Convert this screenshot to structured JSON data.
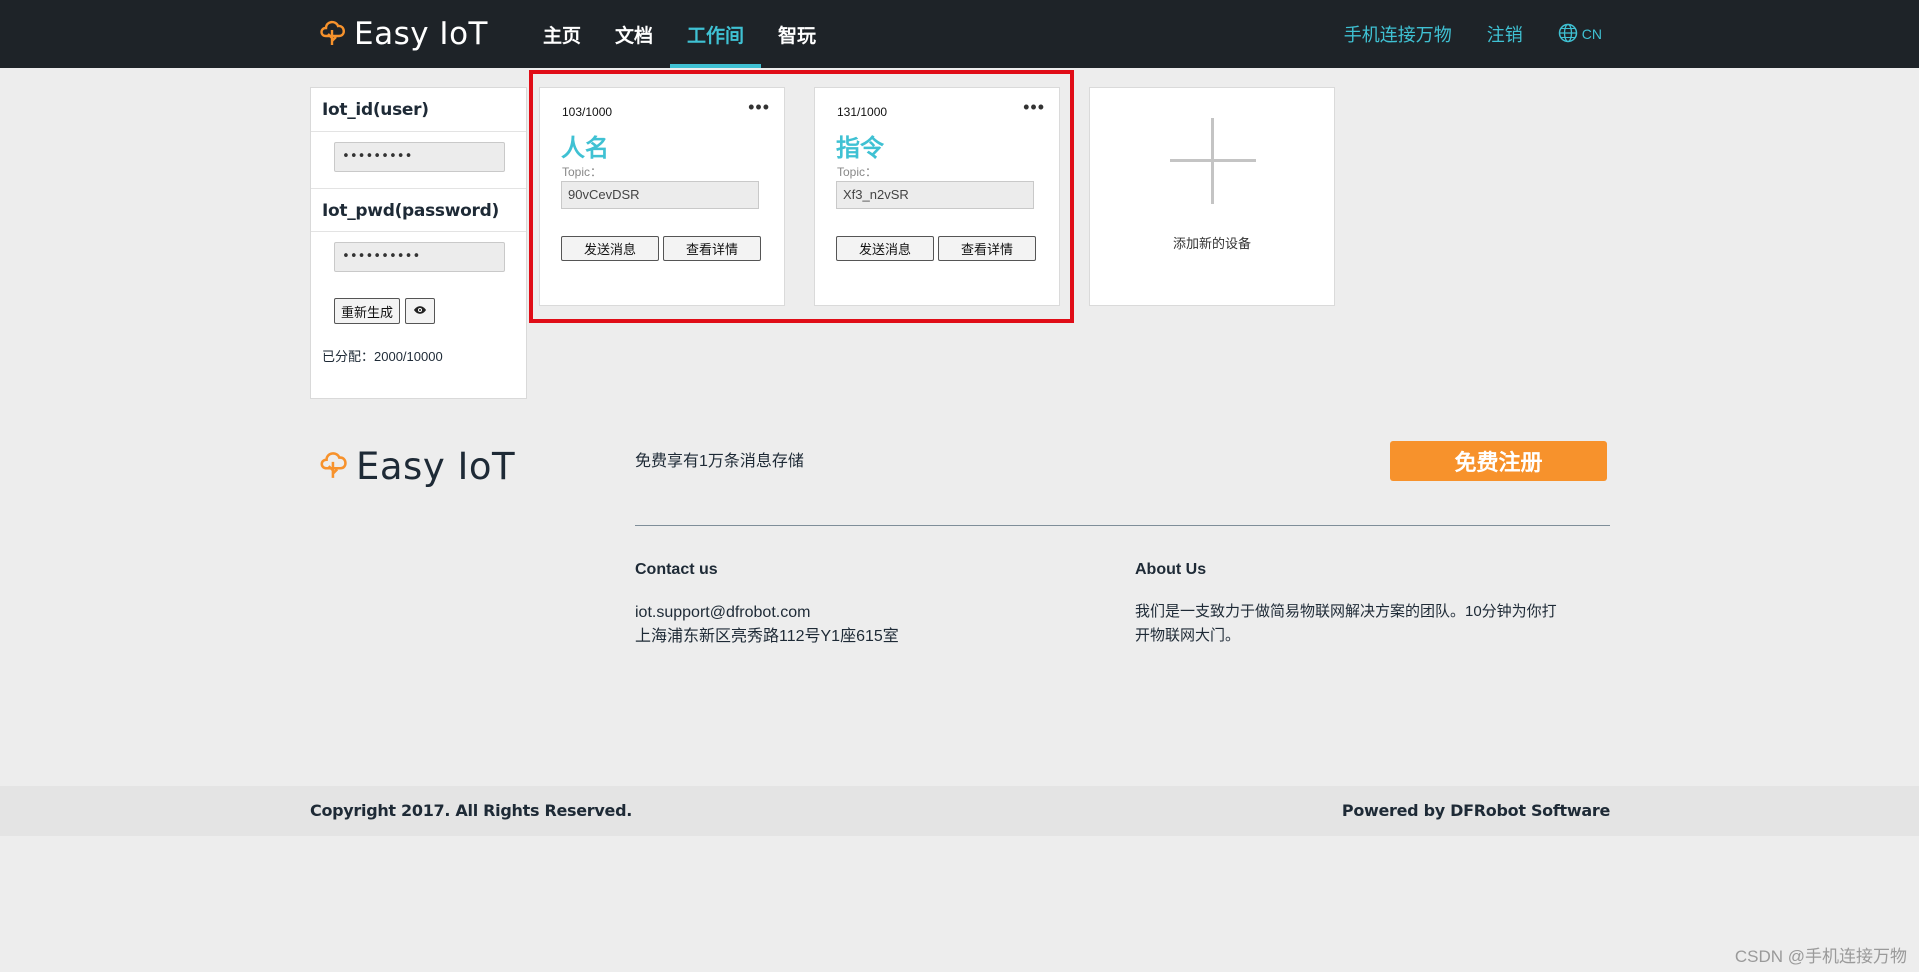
{
  "header": {
    "brand": "Easy IoT",
    "nav": [
      "主页",
      "文档",
      "工作间",
      "智玩"
    ],
    "active_nav": 2,
    "right_links": [
      "手机连接万物",
      "注销"
    ],
    "lang": "CN"
  },
  "credentials": {
    "id_label": "Iot_id(user)",
    "id_value": "•••••••••",
    "pwd_label": "Iot_pwd(password)",
    "pwd_value": "••••••••••",
    "regen_button": "重新生成",
    "allocated": "已分配：2000/10000"
  },
  "devices": [
    {
      "count": "103/1000",
      "name": "人名",
      "topic_label": "Topic：",
      "topic": "90vCevDSR",
      "send": "发送消息",
      "detail": "查看详情"
    },
    {
      "count": "131/1000",
      "name": "指令",
      "topic_label": "Topic：",
      "topic": "Xf3_n2vSR",
      "send": "发送消息",
      "detail": "查看详情"
    }
  ],
  "add_device": {
    "label": "添加新的设备"
  },
  "footer": {
    "brand": "Easy IoT",
    "promo": "免费享有1万条消息存储",
    "signup": "免费注册",
    "contact_heading": "Contact us",
    "contact_email": "iot.support@dfrobot.com",
    "contact_address": "上海浦东新区亮秀路112号Y1座615室",
    "about_heading": "About Us",
    "about_line1": "我们是一支致力于做简易物联网解决方案的团队。10分钟为你打",
    "about_line2": "开物联网大门。",
    "copyright": "Copyright 2017. All Rights Reserved.",
    "powered": "Powered by DFRobot Software"
  },
  "watermark": "CSDN @手机连接万物",
  "colors": {
    "accent": "#3fc1d3",
    "signup": "#f7922c",
    "highlight": "#e00d17",
    "logo": "#f7922c"
  }
}
